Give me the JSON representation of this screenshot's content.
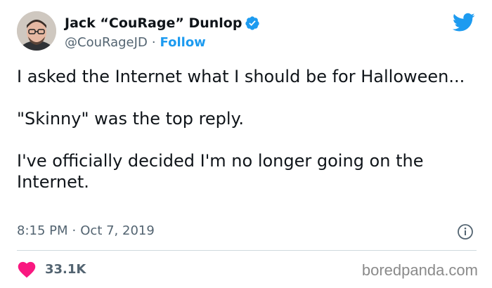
{
  "author": {
    "display_name": "Jack “CouRage” Dunlop",
    "handle": "@CouRageJD",
    "separator": "·",
    "follow_label": "Follow",
    "verified": true
  },
  "tweet": {
    "paragraphs": [
      "I asked the Internet what I should be for Halloween...",
      "\"Skinny\" was the top reply.",
      "I've officially decided I'm no longer going on the Internet."
    ],
    "time": "8:15 PM",
    "date_separator": "·",
    "date": "Oct 7, 2019",
    "likes": "33.1K"
  },
  "watermark": "boredpanda.com",
  "colors": {
    "accent": "#1d9bf0",
    "text": "#0f1419",
    "muted": "#536471",
    "heart": "#f91880"
  },
  "icons": [
    "verified-badge-icon",
    "twitter-bird-icon",
    "info-icon",
    "heart-icon"
  ]
}
